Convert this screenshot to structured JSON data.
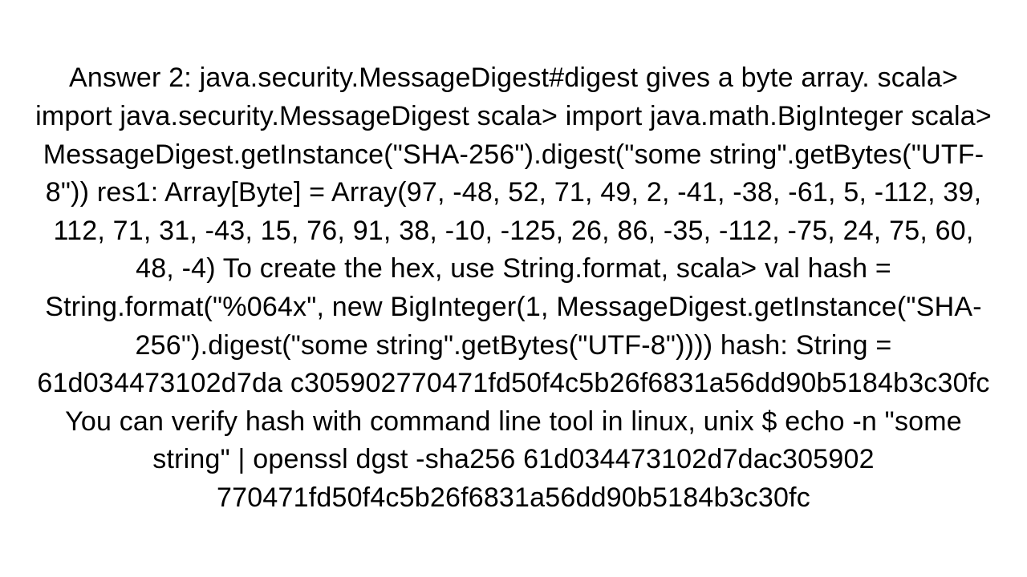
{
  "document": {
    "body_text": "Answer 2: java.security.MessageDigest#digest gives a byte array. scala> import java.security.MessageDigest scala> import java.math.BigInteger  scala> MessageDigest.getInstance(\"SHA-256\").digest(\"some string\".getBytes(\"UTF-8\")) res1: Array[Byte] = Array(97, -48, 52, 71, 49, 2, -41, -38, -61, 5, -112, 39, 112, 71, 31, -43, 15, 76, 91, 38, -10, -125, 26, 86, -35, -112, -75, 24, 75, 60, 48, -4)  To create the hex, use String.format, scala> val hash = String.format(\"%064x\", new BigInteger(1, MessageDigest.getInstance(\"SHA-256\").digest(\"some string\".getBytes(\"UTF-8\")))) hash: String = 61d034473102d7da c305902770471fd50f4c5b26f6831a56dd90b5184b3c30fc  You can verify hash with command line tool in linux, unix $ echo -n \"some string\" | openssl dgst -sha256 61d034473102d7dac305902 770471fd50f4c5b26f6831a56dd90b5184b3c30fc"
  }
}
